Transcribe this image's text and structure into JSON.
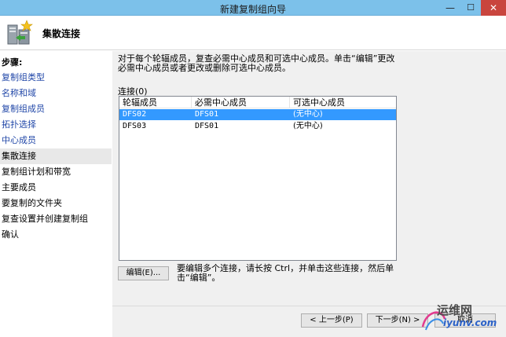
{
  "window": {
    "title": "新建复制组向导",
    "minimize_glyph": "—",
    "maximize_glyph": "☐",
    "close_glyph": "✕"
  },
  "header": {
    "title": "集散连接",
    "icon": "replication-wizard-icon"
  },
  "sidebar": {
    "heading": "步骤:",
    "items": [
      {
        "label": "复制组类型",
        "state": "link"
      },
      {
        "label": "名称和域",
        "state": "link"
      },
      {
        "label": "复制组成员",
        "state": "link"
      },
      {
        "label": "拓扑选择",
        "state": "link"
      },
      {
        "label": "中心成员",
        "state": "link"
      },
      {
        "label": "集散连接",
        "state": "current"
      },
      {
        "label": "复制组计划和带宽",
        "state": "pending"
      },
      {
        "label": "主要成员",
        "state": "pending"
      },
      {
        "label": "要复制的文件夹",
        "state": "pending"
      },
      {
        "label": "复查设置并创建复制组",
        "state": "pending"
      },
      {
        "label": "确认",
        "state": "pending"
      }
    ]
  },
  "main": {
    "description": "对于每个轮辐成员，复查必需中心成员和可选中心成员。单击“编辑”更改必需中心成员或者更改或删除可选中心成员。",
    "connections_label": "连接(0)",
    "table": {
      "columns": [
        "轮辐成员",
        "必需中心成员",
        "可选中心成员"
      ],
      "rows": [
        {
          "spoke": "DFS02",
          "required_hub": "DFS01",
          "optional_hub": "(无中心)",
          "selected": true
        },
        {
          "spoke": "DFS03",
          "required_hub": "DFS01",
          "optional_hub": "(无中心)",
          "selected": false
        }
      ]
    },
    "edit_button": "编辑(E)...",
    "edit_hint": "要编辑多个连接，请长按 Ctrl，并单击这些连接，然后单击“编辑”。"
  },
  "footer": {
    "prev_button": "< 上一步(P)",
    "next_button": "下一步(N) >",
    "cancel_button": "取消"
  },
  "watermark": {
    "line1": "运维网",
    "line2": "iyunv.com"
  },
  "colors": {
    "titlebar": "#7cc1ea",
    "close": "#c9453e",
    "selection": "#3399ff",
    "link": "#2147a8"
  }
}
